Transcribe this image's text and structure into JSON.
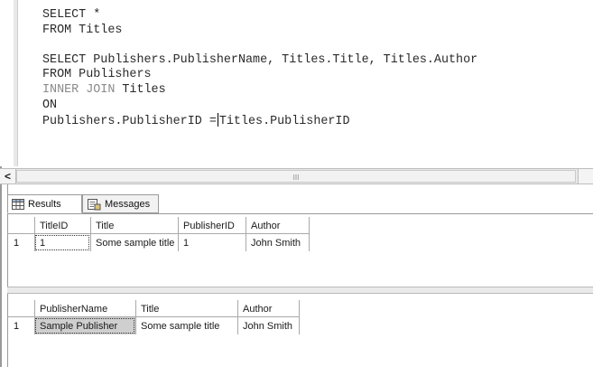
{
  "editor": {
    "lines": [
      [
        {
          "t": "SELECT *",
          "m": false
        }
      ],
      [
        {
          "t": "FROM Titles",
          "m": false
        }
      ],
      [
        {
          "t": "",
          "m": false
        }
      ],
      [
        {
          "t": "SELECT Publishers.PublisherName, Titles.Title, Titles.Author",
          "m": false
        }
      ],
      [
        {
          "t": "FROM Publishers",
          "m": false
        }
      ],
      [
        {
          "t": "INNER JOIN",
          "m": true
        },
        {
          "t": " Titles",
          "m": false
        }
      ],
      [
        {
          "t": "ON",
          "m": false
        }
      ],
      [
        {
          "t": "Publishers.PublisherID =",
          "m": false
        },
        {
          "caret": true
        },
        {
          "t": "Titles.PublisherID",
          "m": false
        }
      ]
    ]
  },
  "scrollbar": {
    "left_arrow": "<",
    "grip": "III"
  },
  "tabs": [
    {
      "label": "Results",
      "icon": "grid-results-icon",
      "active": true
    },
    {
      "label": "Messages",
      "icon": "messages-icon",
      "active": false
    }
  ],
  "results1": {
    "columns": [
      "TitleID",
      "Title",
      "PublisherID",
      "Author"
    ],
    "rows": [
      {
        "num": "1",
        "cells": [
          "1",
          "Some sample title",
          "1",
          "John Smith"
        ]
      }
    ]
  },
  "results2": {
    "columns": [
      "PublisherName",
      "Title",
      "Author"
    ],
    "rows": [
      {
        "num": "1",
        "cells": [
          "Sample Publisher",
          "Some sample title",
          "John Smith"
        ]
      }
    ]
  }
}
